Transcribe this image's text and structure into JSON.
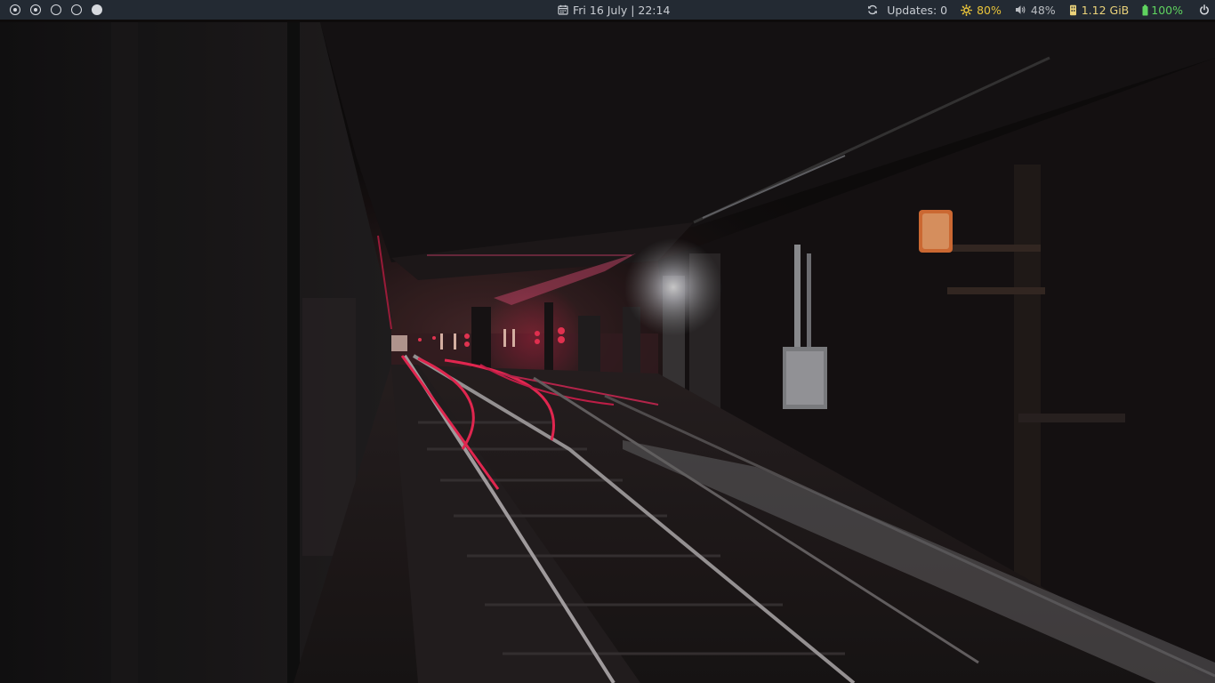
{
  "workspaces": [
    {
      "state": "occupied"
    },
    {
      "state": "occupied"
    },
    {
      "state": "empty"
    },
    {
      "state": "empty"
    },
    {
      "state": "active"
    }
  ],
  "clock": {
    "icon": "calendar-icon",
    "text": "Fri 16 July | 22:14"
  },
  "modules": {
    "updates": {
      "icon": "refresh-icon",
      "text": "Updates: 0",
      "color": "#c8ccd2"
    },
    "brightness": {
      "icon": "sun-icon",
      "text": "80%",
      "color": "#e8c33a"
    },
    "volume": {
      "icon": "speaker-icon",
      "text": "48%",
      "color": "#b9bcc1"
    },
    "memory": {
      "icon": "memory-icon",
      "text": "1.12 GiB",
      "color": "#ead27a"
    },
    "battery": {
      "icon": "battery-icon",
      "text": "100%",
      "color": "#5fd35f"
    },
    "power": {
      "icon": "power-icon",
      "color": "#d6d9de"
    }
  },
  "colors": {
    "bar_background": "#232a33",
    "bar_text": "#c8ccd2"
  }
}
